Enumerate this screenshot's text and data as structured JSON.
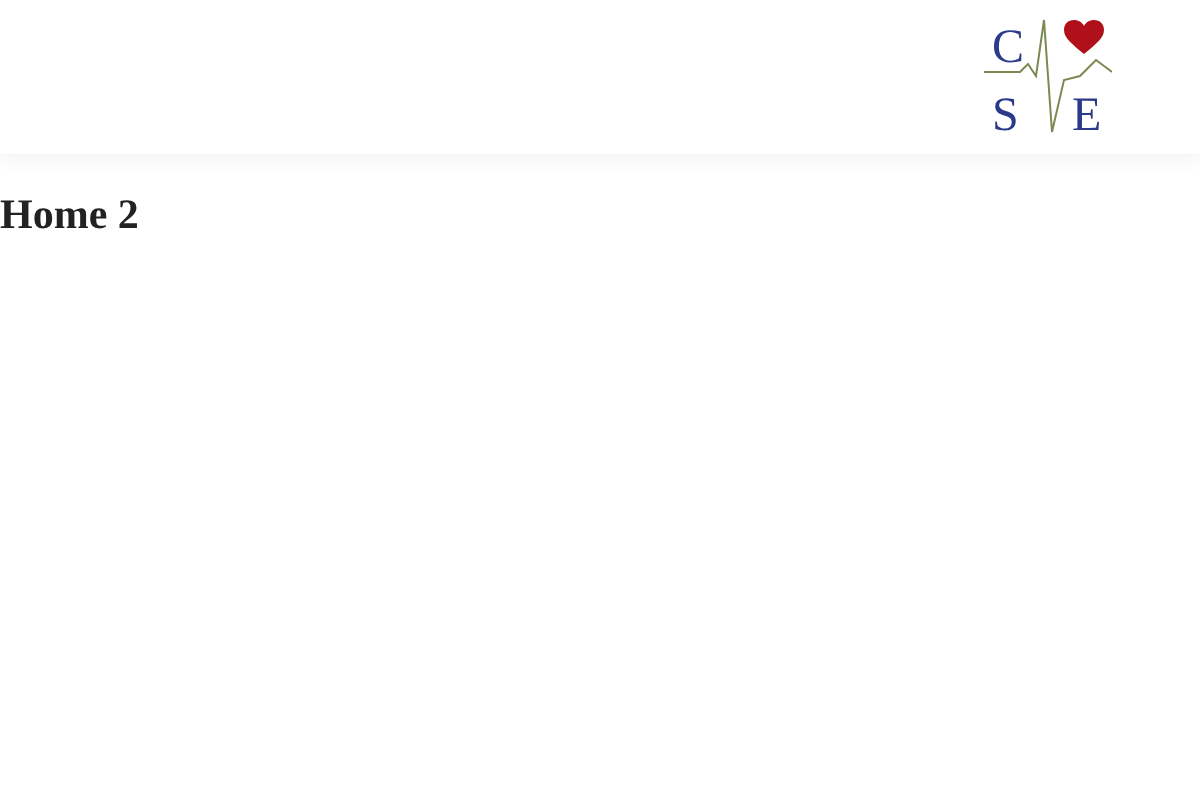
{
  "header": {
    "logo": {
      "letters": [
        "C",
        "S",
        "E"
      ]
    }
  },
  "page": {
    "title": "Home 2"
  }
}
